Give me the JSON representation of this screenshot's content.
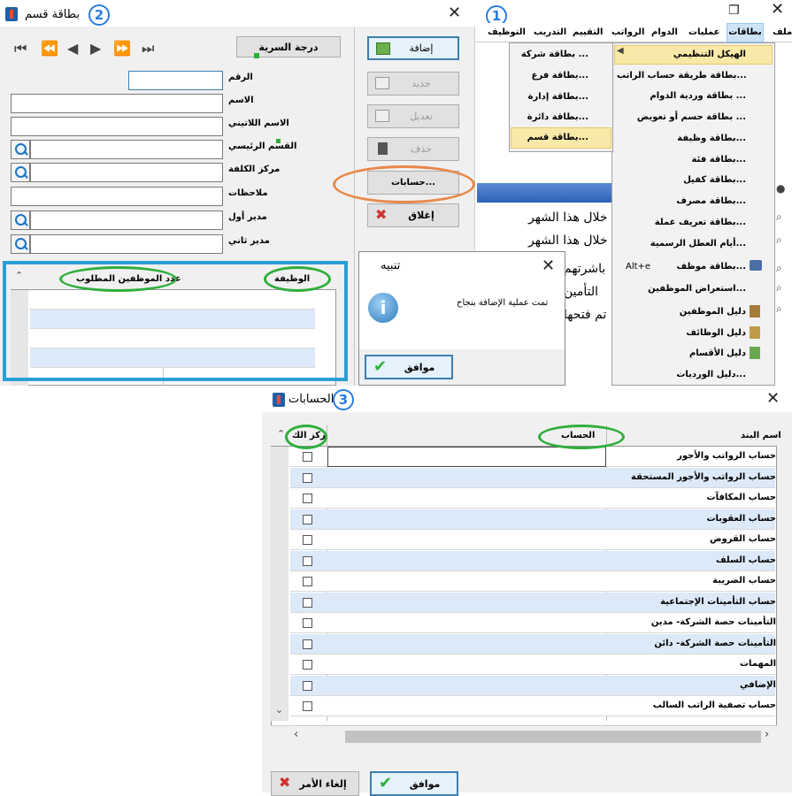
{
  "window1": {
    "menubar": [
      "ملف",
      "بطاقات",
      "عمليات",
      "الدوام",
      "الرواتب",
      "التقييم",
      "التدريب",
      "التوظيف"
    ],
    "menu_items": [
      {
        "label": "الهيكل التنظيمي"
      },
      {
        "label": "بطاقة طريقة حساب الراتب..."
      },
      {
        "label": "بطاقة وردية الدوام ..."
      },
      {
        "label": "بطاقة حسم أو تعويض ..."
      },
      {
        "label": "بطاقة وظيفة..."
      },
      {
        "label": "بطاقة فئة..."
      },
      {
        "label": "بطاقة كفيل..."
      },
      {
        "label": "بطاقة مصرف..."
      },
      {
        "label": "بطاقة تعريف عملة..."
      },
      {
        "label": "أيام العطل الرسمية..."
      },
      {
        "label": "بطاقة موظف...",
        "shortcut": "Alt+e"
      },
      {
        "label": "استعراض الموظفين..."
      },
      {
        "label": "دليل الموظفين"
      },
      {
        "label": "دليل الوظائف"
      },
      {
        "label": "دليل الأقسام"
      },
      {
        "label": "دليل الورديات..."
      }
    ],
    "submenu_items": [
      "بطاقة شركة ...",
      "بطاقة فرع...",
      "بطاقة إدارة...",
      "بطاقة دائرة...",
      "بطاقة قسم..."
    ],
    "bg_text": [
      "خلال هذا الشهر",
      "خلال هذا الشهر",
      "باشرتهم",
      "التأمين",
      "تم فتحها"
    ],
    "badge": "1"
  },
  "window2": {
    "title": "بطاقة قسم",
    "badge": "2",
    "security_button": "درجة السرية",
    "fields": {
      "number": "الرقم",
      "name": "الاسم",
      "latin_name": "الاسم اللاتيني",
      "main_section": "القسم الرئيسي",
      "cost_center": "مركز الكلفة",
      "notes": "ملاحظات",
      "manager1": "مدير أول",
      "manager2": "مدير ثاني"
    },
    "buttons": {
      "add": "إضافة",
      "new": "جديد",
      "edit": "تعديل",
      "delete": "حذف",
      "accounts": "حسابات...",
      "close": "إغلاق"
    },
    "grid_headers": {
      "job": "الوظيفة",
      "count": "عدد الموظفين المطلوب"
    }
  },
  "alert": {
    "title": "تنبيه",
    "message": "تمت عملية الإضافة بنجاح",
    "ok": "موافق"
  },
  "window3": {
    "title": "الحسابات",
    "badge": "3",
    "headers": {
      "item": "اسم البند",
      "account": "الحساب",
      "cost_center": "مركز الك"
    },
    "rows": [
      "حساب الرواتب والأجور",
      "حساب الرواتب والأجور المستحقة",
      "حساب المكافآت",
      "حساب العقوبات",
      "حساب القروض",
      "حساب السلف",
      "حساب الضريبة",
      "حساب التأمينات الإجتماعية",
      "التأمينات حصة الشركة- مدين",
      "التأمينات حصة الشركة- دائن",
      "المهمات",
      "الإضافي",
      "حساب تصفية الراتب السالب"
    ],
    "buttons": {
      "ok": "موافق",
      "cancel": "إلغاء الأمر"
    }
  },
  "colors": {
    "highlight": "#f9e9a8",
    "row_alt": "#dce9f9",
    "annotation_blue": "#2a9fd6",
    "annotation_green": "#2fae3c",
    "annotation_orange": "#e8884a"
  }
}
